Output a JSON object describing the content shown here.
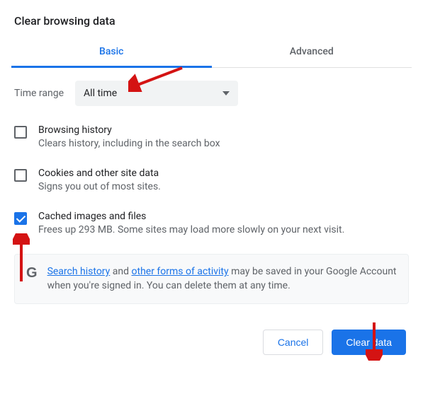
{
  "title": "Clear browsing data",
  "tabs": {
    "basic": "Basic",
    "advanced": "Advanced"
  },
  "time_range": {
    "label": "Time range",
    "selected": "All time"
  },
  "options": [
    {
      "checked": false,
      "title": "Browsing history",
      "desc": "Clears history, including in the search box"
    },
    {
      "checked": false,
      "title": "Cookies and other site data",
      "desc": "Signs you out of most sites."
    },
    {
      "checked": true,
      "title": "Cached images and files",
      "desc": "Frees up 293 MB. Some sites may load more slowly on your next visit."
    }
  ],
  "info": {
    "link1": "Search history",
    "mid1": " and ",
    "link2": "other forms of activity",
    "mid2": " may be saved in your Google Account when you're signed in. You can delete them at any time."
  },
  "actions": {
    "cancel": "Cancel",
    "clear": "Clear data"
  },
  "annotations": {
    "arrows": [
      {
        "points_to": "time-range-select"
      },
      {
        "points_to": "cached-files-checkbox"
      },
      {
        "points_to": "clear-data-button"
      }
    ]
  }
}
